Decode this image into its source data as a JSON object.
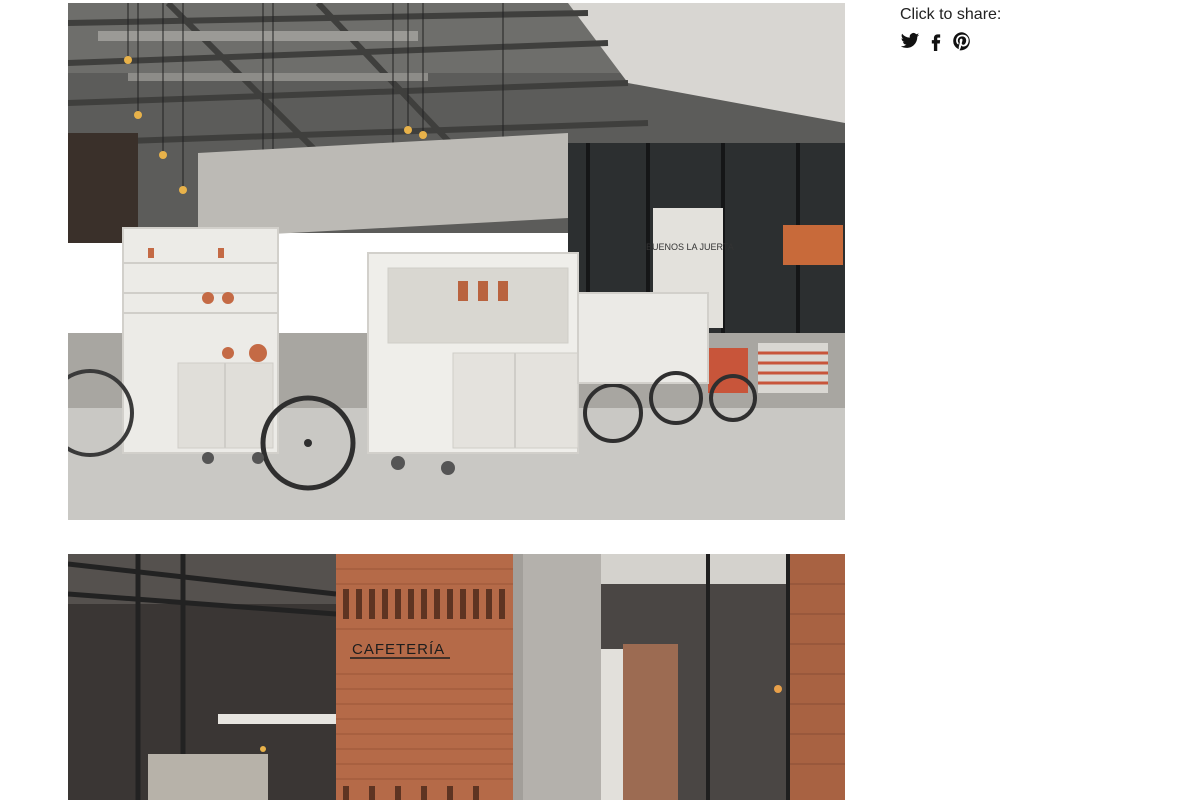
{
  "share": {
    "label": "Click to share:",
    "icons": [
      "twitter-icon",
      "facebook-icon",
      "pinterest-icon"
    ]
  },
  "photos": {
    "first": {
      "signage": "BUENOS LA JUERTA"
    },
    "second": {
      "signage": "CAFETERÍA"
    }
  },
  "colors": {
    "text": "#222222",
    "icon": "#111111",
    "background": "#ffffff"
  }
}
